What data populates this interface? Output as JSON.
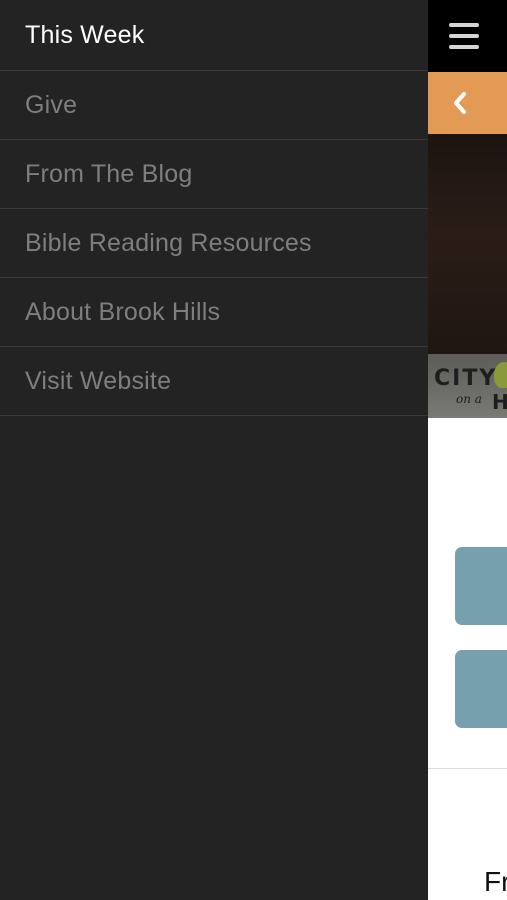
{
  "menu": {
    "items": [
      {
        "label": "This Week",
        "active": true
      },
      {
        "label": "Give",
        "active": false
      },
      {
        "label": "From The Blog",
        "active": false
      },
      {
        "label": "Bible Reading Resources",
        "active": false
      },
      {
        "label": "About Brook Hills",
        "active": false
      },
      {
        "label": "Visit Website",
        "active": false
      }
    ]
  },
  "page": {
    "topbar_icon": "hamburger-menu-icon",
    "back_icon": "chevron-left-icon",
    "accent_color": "#e39a55",
    "tile_color": "#77a0ae",
    "logo": {
      "word": "CITY",
      "sub": "on a",
      "trailing_letter": "H"
    },
    "bottom_text": "Fr"
  }
}
